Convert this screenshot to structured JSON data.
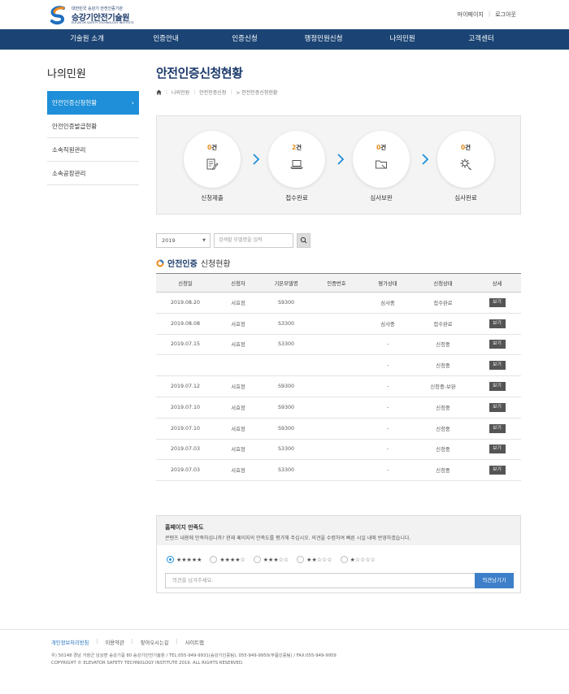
{
  "header": {
    "logo_sub": "대한민국 승강기 안전인증기관",
    "logo_title": "승강기안전기술원",
    "logo_eng": "ELEVATOR SAFETY TECHNOLOGY INSTITUTE",
    "util_links": [
      "마이페이지",
      "로그아웃"
    ]
  },
  "gnb": [
    "기술원 소개",
    "인증안내",
    "인증신청",
    "행정민원신청",
    "나의민원",
    "고객센터"
  ],
  "sidebar": {
    "title": "나의민원",
    "items": [
      {
        "label": "안전인증신청현황",
        "active": true
      },
      {
        "label": "안전인증발급현황",
        "active": false
      },
      {
        "label": "소속직원관리",
        "active": false
      },
      {
        "label": "소속공장관리",
        "active": false
      }
    ]
  },
  "page": {
    "title": "안전인증신청현황",
    "breadcrumb": [
      "나의민원",
      "안전인증신청",
      "> 안전인증신청현황"
    ]
  },
  "steps": [
    {
      "num": "0",
      "unit": "건",
      "label": "신청제출",
      "icon": "edit-document-icon"
    },
    {
      "num": "2",
      "unit": "건",
      "label": "접수완료",
      "icon": "laptop-icon"
    },
    {
      "num": "0",
      "unit": "건",
      "label": "심사보완",
      "icon": "folder-icon"
    },
    {
      "num": "0",
      "unit": "건",
      "label": "심사완료",
      "icon": "gear-icon"
    }
  ],
  "filter": {
    "year": "2019",
    "search_placeholder": "검색할 모델명을 입력"
  },
  "section": {
    "title_bold": "안전인증",
    "title_rest": "신청현황"
  },
  "table": {
    "headers": [
      "신청일",
      "신청자",
      "기본모델명",
      "인증번호",
      "평가상태",
      "신청상태",
      "상세"
    ],
    "button_label": "보기",
    "rows": [
      [
        "2019.08.20",
        "서효정",
        "S9300",
        "",
        "심사중",
        "접수완료"
      ],
      [
        "2019.08.08",
        "서효정",
        "S3300",
        "",
        "심사중",
        "접수완료"
      ],
      [
        "2019.07.15",
        "서효정",
        "S3300",
        "",
        "-",
        "신청중"
      ],
      [
        "",
        "",
        "",
        "",
        "-",
        "신청중"
      ],
      [
        "2019.07.12",
        "서효정",
        "S9300",
        "",
        "-",
        "신청중-보완"
      ],
      [
        "2019.07.10",
        "서효정",
        "S9300",
        "",
        "-",
        "신청중"
      ],
      [
        "2019.07.10",
        "서효정",
        "S9300",
        "",
        "-",
        "신청중"
      ],
      [
        "2019.07.03",
        "서효정",
        "S3300",
        "",
        "-",
        "신청중"
      ],
      [
        "2019.07.03",
        "서효정",
        "S3300",
        "",
        "-",
        "신청중"
      ]
    ]
  },
  "survey": {
    "title": "홈페이지 만족도",
    "desc": "콘텐츠 내용에 만족하십니까? 현재 페이지의 만족도를 평가해 주십시오. 의견을 수렴하여 빠른 시일 내에 반영하겠습니다.",
    "ratings": [
      "★★★★★",
      "★★★★☆",
      "★★★☆☆",
      "★★☆☆☆",
      "★☆☆☆☆"
    ],
    "selected_rating": 0,
    "opinion_placeholder": "의견을 남겨주세요.",
    "submit_label": "의견남기기"
  },
  "footer": {
    "links": [
      "개인정보처리방침",
      "이용약관",
      "찾아오시는길",
      "사이트맵"
    ],
    "address": "우) 50148 경남 거창군 남상면 승강기길 80 승강기안전기술원 / TEL:055-949-9931(승강기인증팀), 055-949-9950(부품인증팀) / FAX:055-949-9959",
    "copyright": "COPYRIGHT © ELEVATOR SAFETY TECHNOLOGY INSTITUTE 2019. ALL RIGHTS RESERVED."
  },
  "colors": {
    "navy": "#1b4474",
    "accent_blue": "#1e8fd8",
    "count_orange": "#e88b1a",
    "button_dark": "#555555"
  }
}
